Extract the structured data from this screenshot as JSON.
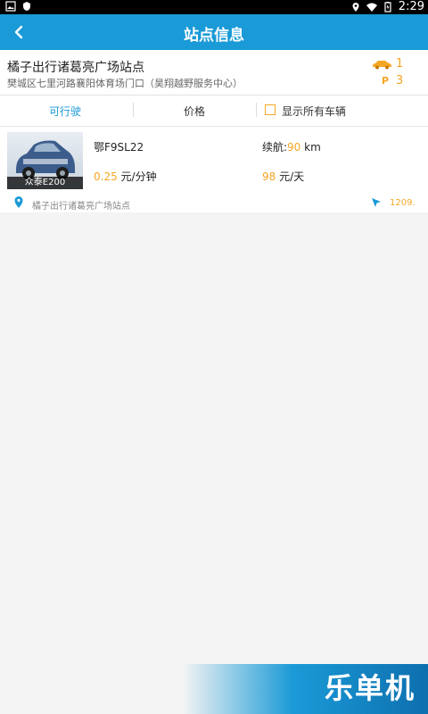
{
  "status_bar": {
    "time": "2:29"
  },
  "header": {
    "title": "站点信息"
  },
  "station": {
    "name": "橘子出行诸葛亮广场站点",
    "address": "樊城区七里河路襄阳体育场门口（昊翔越野服务中心）",
    "available_cars": "1",
    "parking_label": "P",
    "parking_count": "3"
  },
  "tabs": {
    "drivable": "可行驶",
    "price": "价格",
    "show_all": "显示所有车辆"
  },
  "vehicle": {
    "model": "众泰E200",
    "plate": "鄂F9SL22",
    "range_label": "续航:",
    "range_value": "90",
    "range_unit": " km",
    "price_per_min": "0.25",
    "price_per_min_unit": " 元/分钟",
    "price_per_day": "98",
    "price_per_day_unit": " 元/天",
    "location": "橘子出行诸葛亮广场站点",
    "distance": "1209."
  },
  "watermark": {
    "text": "乐单机"
  },
  "colors": {
    "accent": "#1a9ad7",
    "highlight": "#f5a623"
  }
}
